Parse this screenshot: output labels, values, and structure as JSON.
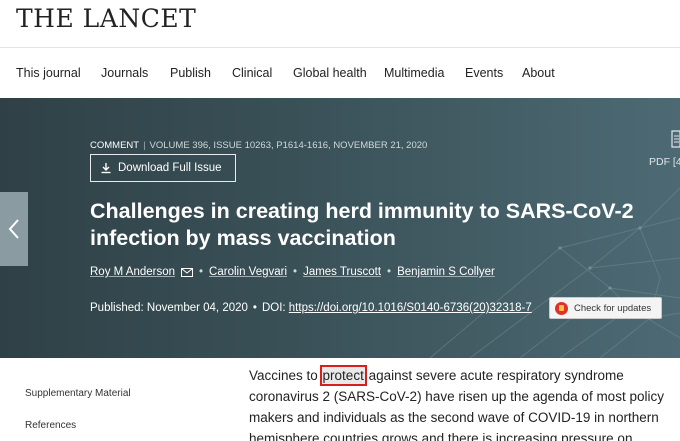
{
  "logo": "THE LANCET",
  "nav": [
    "This journal",
    "Journals",
    "Publish",
    "Clinical",
    "Global health",
    "Multimedia",
    "Events",
    "About"
  ],
  "article": {
    "type": "COMMENT",
    "volume": "VOLUME 396, ISSUE 10263, P1614-1616, NOVEMBER 21, 2020",
    "download_label": "Download Full Issue",
    "pdf_label": "PDF [4",
    "title_line1": "Challenges in creating herd immunity to SARS-CoV-2",
    "title_line2": "infection by mass vaccination",
    "authors": [
      "Roy M Anderson",
      "Carolin Vegvari",
      "James Truscott",
      "Benjamin S Collyer"
    ],
    "published_label": "Published: November 04, 2020",
    "doi_label": "DOI:",
    "doi": "https://doi.org/10.1016/S0140-6736(20)32318-7",
    "check_updates": "Check for updates"
  },
  "sidebar": [
    "Supplementary Material",
    "References"
  ],
  "body": {
    "line1_before": "Vaccines to ",
    "line1_highlight": "protect",
    "line1_after": " against severe acute respiratory syndrome",
    "line2": "coronavirus 2 (SARS-CoV-2) have risen up the agenda of most policy",
    "line3": "makers and individuals as the second wave of COVID-19 in northern",
    "line4": "hemisphere countries grows and there is increasing pressure on"
  },
  "colors": {
    "hero": "#3a5158",
    "highlight_border": "#d81e1e",
    "check_badge": "#e0322d"
  }
}
